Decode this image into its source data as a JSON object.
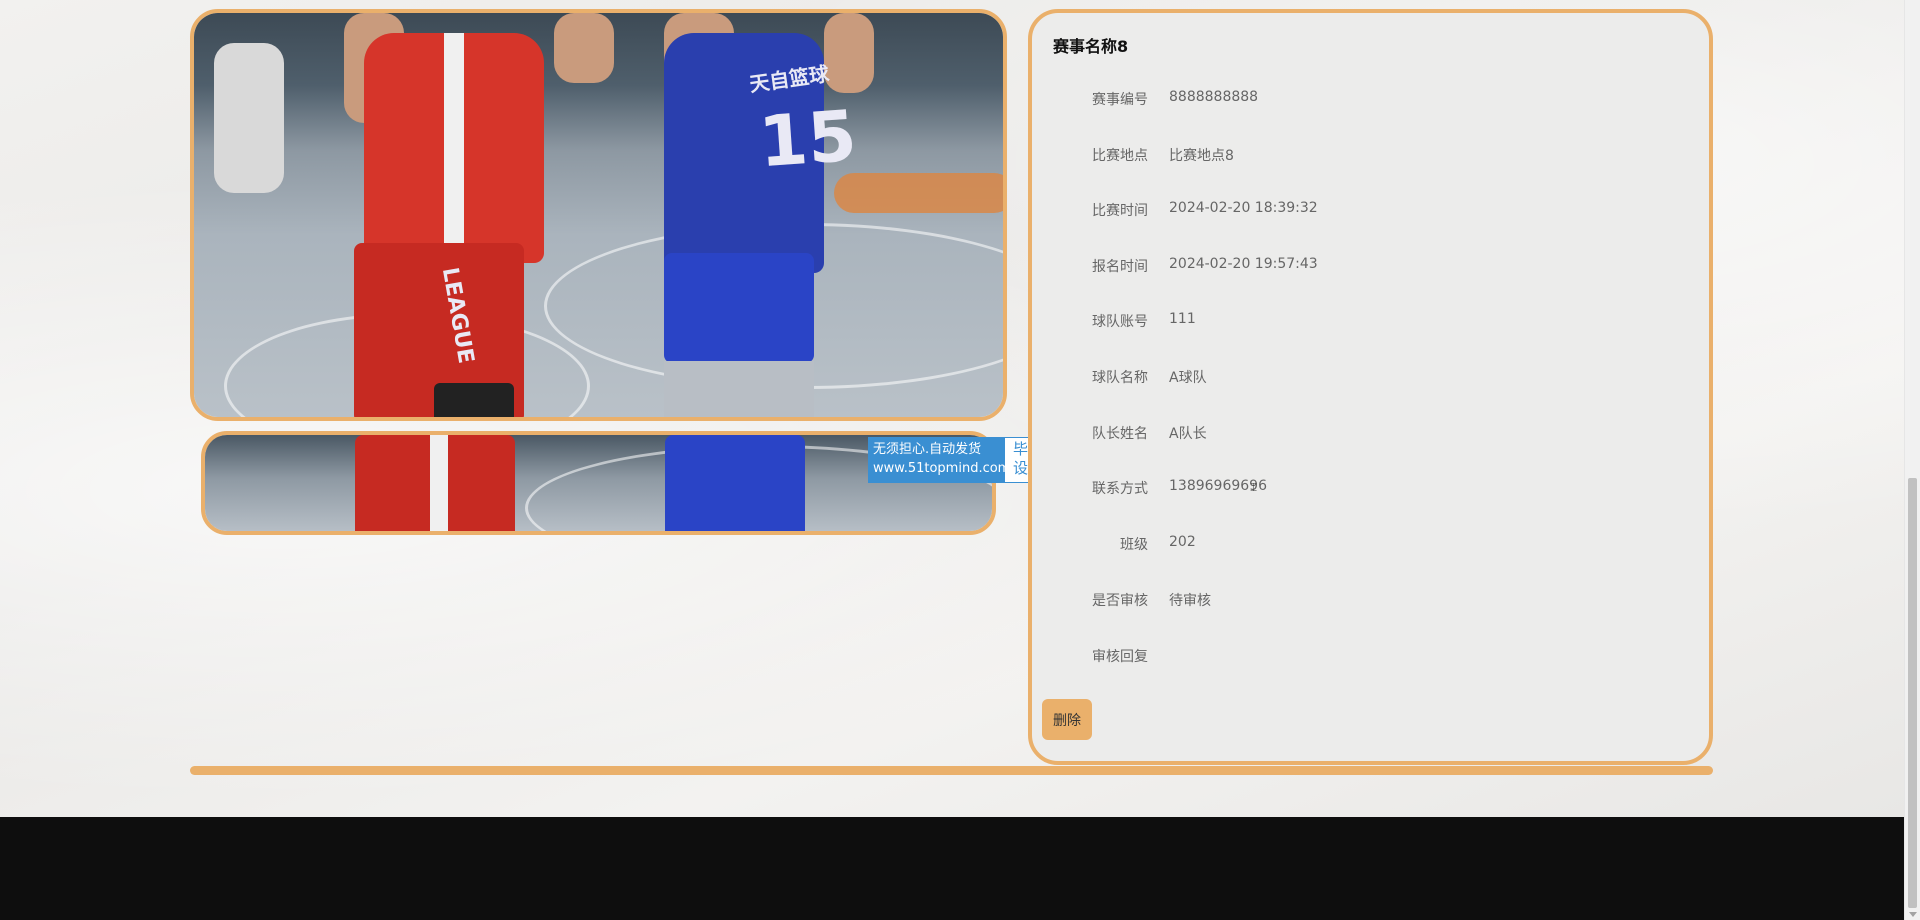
{
  "detail": {
    "title": "赛事名称8",
    "fields": [
      {
        "label": "赛事编号",
        "value": "8888888888"
      },
      {
        "label": "比赛地点",
        "value": "比赛地点8"
      },
      {
        "label": "比赛时间",
        "value": "2024-02-20 18:39:32"
      },
      {
        "label": "报名时间",
        "value": "2024-02-20 19:57:43"
      },
      {
        "label": "球队账号",
        "value": "111"
      },
      {
        "label": "球队名称",
        "value": "A球队"
      },
      {
        "label": "队长姓名",
        "value": "A队长"
      },
      {
        "label": "联系方式",
        "value": "13896969696"
      },
      {
        "label": "班级",
        "value": "202"
      },
      {
        "label": "是否审核",
        "value": "待审核"
      },
      {
        "label": "审核回复",
        "value": ""
      }
    ],
    "delete_label": "删除"
  },
  "watermark": {
    "line1": "无须担心.自动发货",
    "line2": "www.51topmind.com",
    "side1": "毕业",
    "side2": "设计"
  },
  "images": {
    "main_alt_icon": "basketball-photo",
    "jersey_text": "天自篮球",
    "jersey_number": "15",
    "shorts_text": "LEAGUE"
  },
  "colors": {
    "accent": "#eab06b",
    "footer": "#0e0e0e",
    "watermark_blue": "#3a8fd2"
  }
}
